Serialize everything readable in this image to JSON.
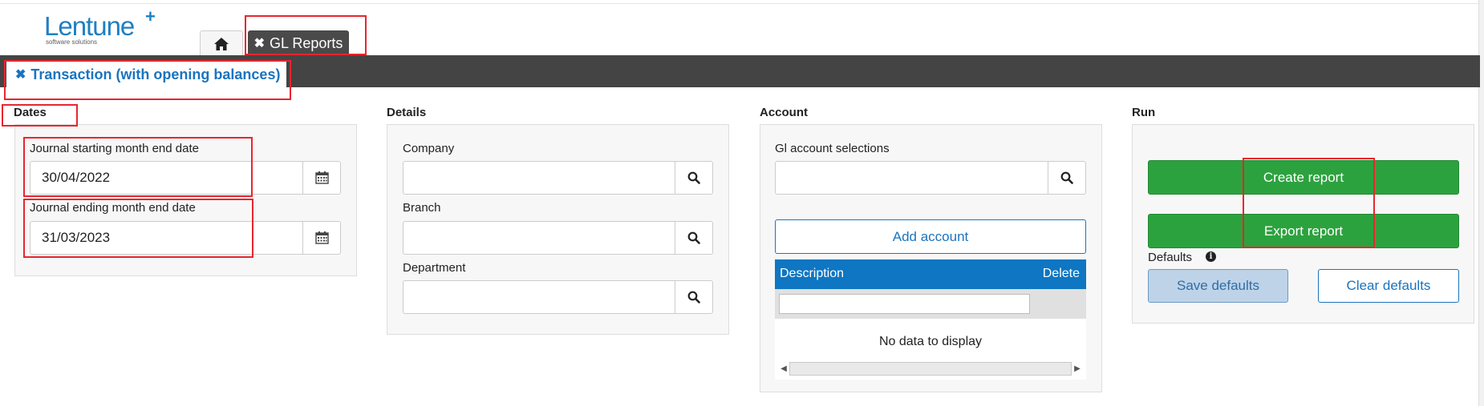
{
  "app": {
    "logo_text": "Lentune",
    "logo_plus": "+",
    "logo_subtitle": "software solutions"
  },
  "tabs": {
    "home_icon": "home-icon",
    "active_close": "✖",
    "active_label": "GL Reports"
  },
  "subtab": {
    "close": "✖",
    "label": "Transaction (with opening balances)"
  },
  "dates": {
    "title": "Dates",
    "start_label": "Journal starting month end date",
    "start_value": "30/04/2022",
    "end_label": "Journal ending month end date",
    "end_value": "31/03/2023"
  },
  "details": {
    "title": "Details",
    "company_label": "Company",
    "company_value": "",
    "branch_label": "Branch",
    "branch_value": "",
    "department_label": "Department",
    "department_value": ""
  },
  "account": {
    "title": "Account",
    "gl_label": "Gl account selections",
    "gl_value": "",
    "add_account_label": "Add account",
    "grid": {
      "columns": [
        "Description",
        "Delete"
      ],
      "filter_value": "",
      "empty_text": "No data to display"
    }
  },
  "run": {
    "title": "Run",
    "create_label": "Create report",
    "export_label": "Export report",
    "defaults_label": "Defaults",
    "save_defaults_label": "Save defaults",
    "clear_defaults_label": "Clear defaults"
  },
  "colors": {
    "brand_blue": "#1e7fc2",
    "tab_dark": "#4a4a4a",
    "bar_dark": "#444444",
    "green": "#2ca23e",
    "grid_header": "#0e76c2",
    "highlight_red": "#e8262e"
  }
}
